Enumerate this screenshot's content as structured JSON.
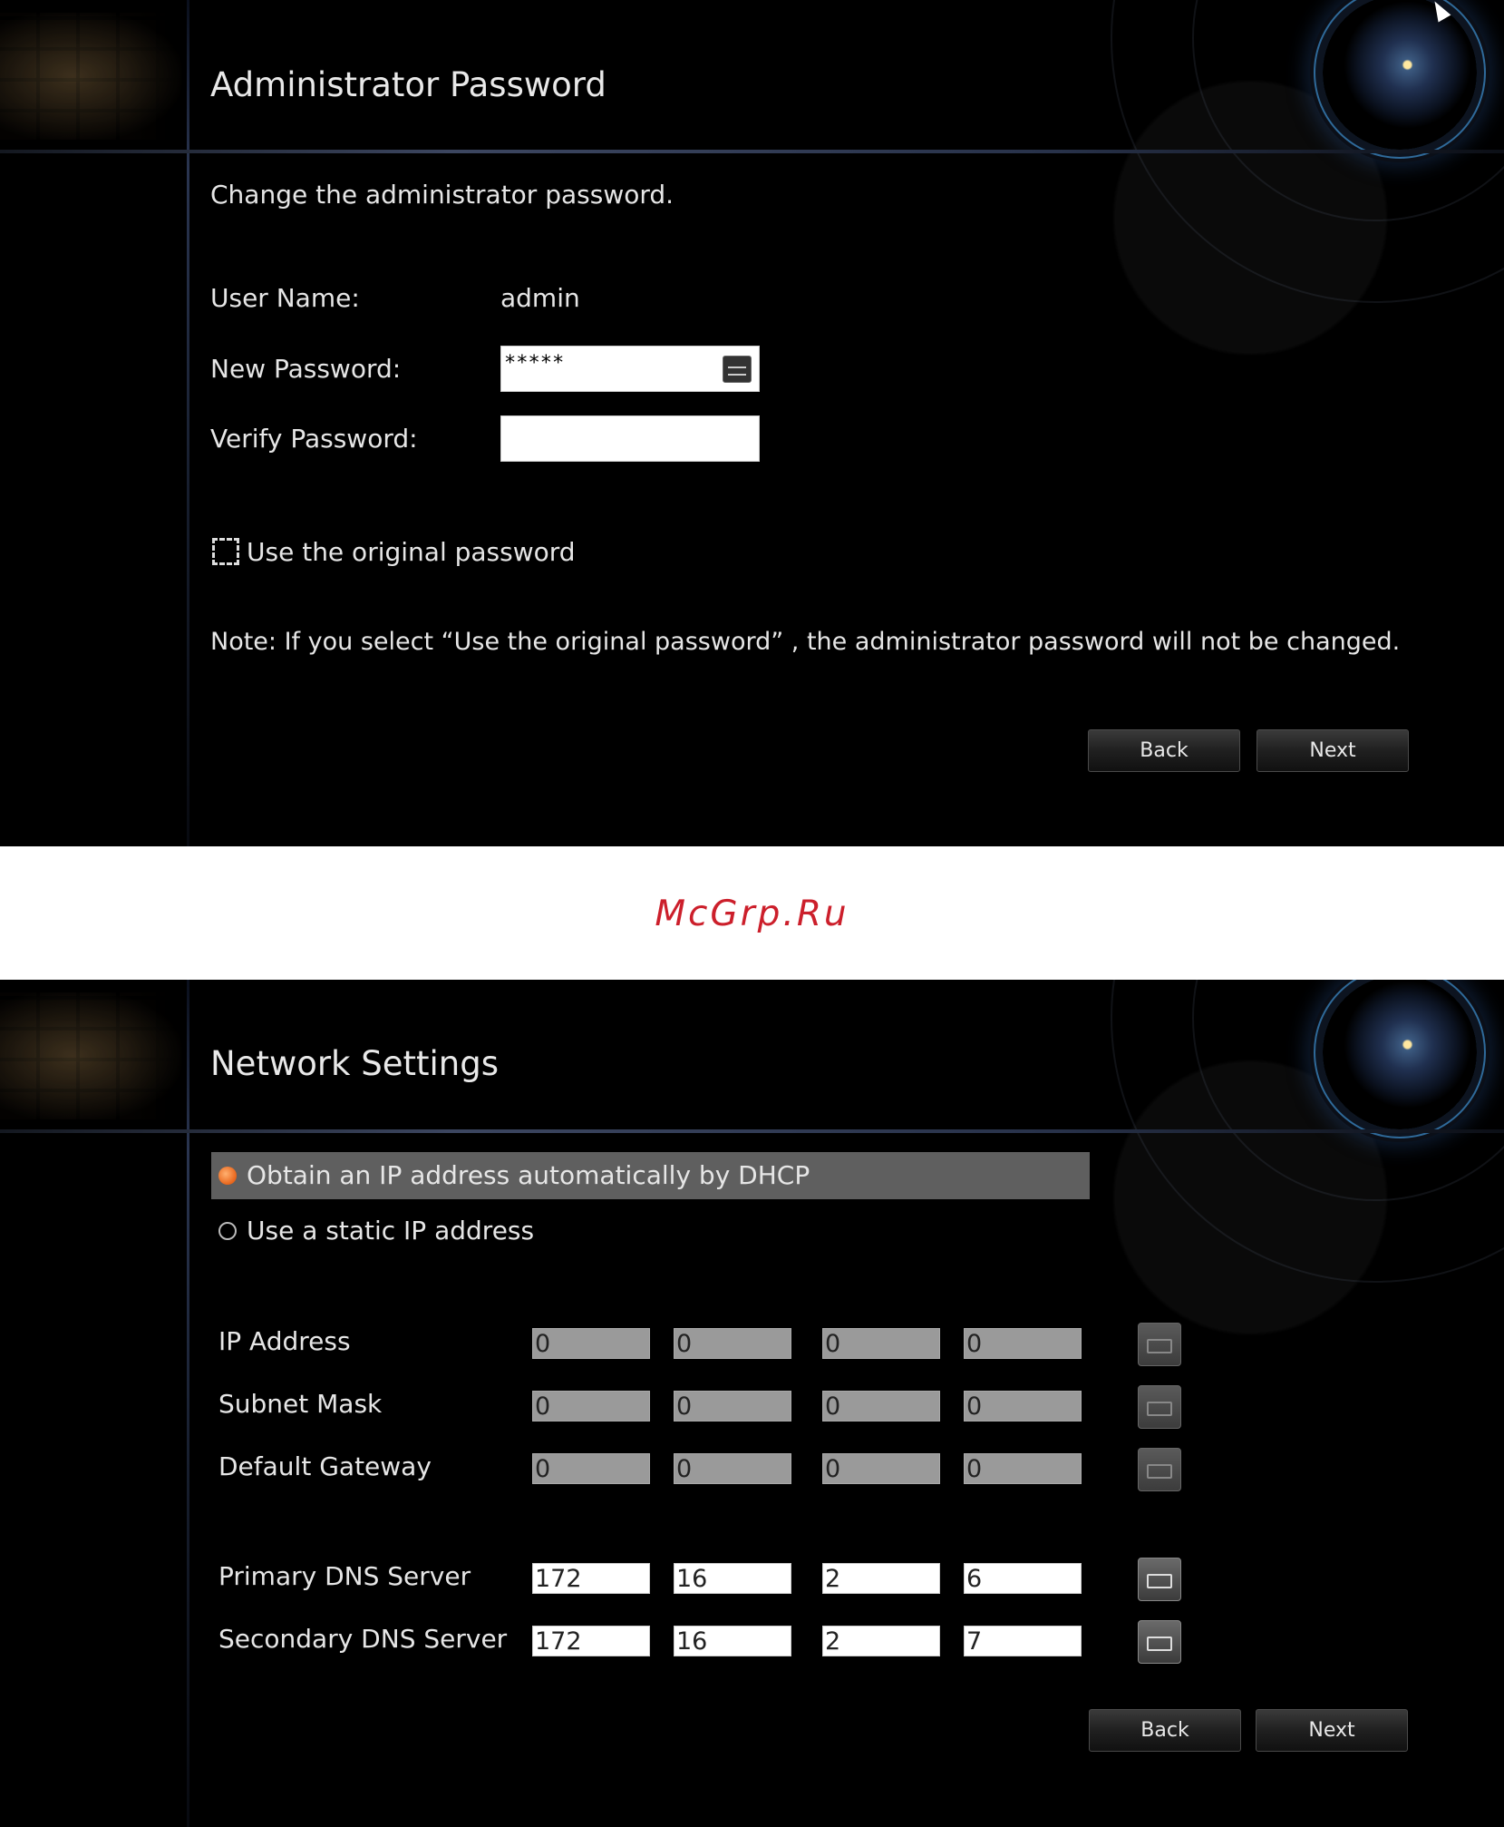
{
  "admin_password": {
    "title": "Administrator Password",
    "description": "Change the administrator password.",
    "user_name_label": "User Name:",
    "user_name_value": "admin",
    "new_password_label": "New Password:",
    "new_password_value": "*****",
    "verify_password_label": "Verify Password:",
    "verify_password_value": "",
    "use_original_label": "Use the original password",
    "note": "Note: If you select “Use the original password” , the administrator password will not be changed.",
    "back_label": "Back",
    "next_label": "Next"
  },
  "watermark": "McGrp.Ru",
  "network_settings": {
    "title": "Network Settings",
    "dhcp_label": "Obtain an IP address automatically by DHCP",
    "static_label": "Use a static IP address",
    "selected_mode": "dhcp",
    "rows": [
      {
        "label": "IP Address",
        "octets": [
          "0",
          "0",
          "0",
          "0"
        ],
        "enabled": false
      },
      {
        "label": "Subnet Mask",
        "octets": [
          "0",
          "0",
          "0",
          "0"
        ],
        "enabled": false
      },
      {
        "label": "Default Gateway",
        "octets": [
          "0",
          "0",
          "0",
          "0"
        ],
        "enabled": false
      },
      {
        "label": "Primary DNS Server",
        "octets": [
          "172",
          "16",
          "2",
          "6"
        ],
        "enabled": true
      },
      {
        "label": "Secondary DNS Server",
        "octets": [
          "172",
          "16",
          "2",
          "7"
        ],
        "enabled": true
      }
    ],
    "back_label": "Back",
    "next_label": "Next"
  },
  "colors": {
    "background": "#000000",
    "accent_radio": "#e8651b",
    "watermark": "#cc1f2b",
    "selected_row": "#5f5f5f"
  },
  "icons": [
    "keyboard-icon",
    "camera-lens-graphic",
    "mouse-cursor-icon"
  ]
}
